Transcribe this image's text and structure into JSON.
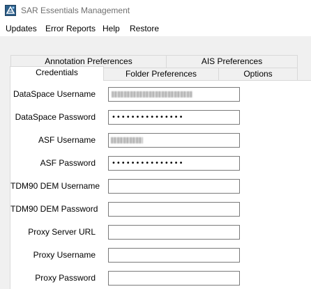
{
  "window": {
    "title": "SAR Essentials Management",
    "icon": "sar-app-icon"
  },
  "menu": {
    "items": [
      "Updates",
      "Error Reports",
      "Help",
      "Restore"
    ]
  },
  "tabs": {
    "back_row": [
      "Annotation Preferences",
      "AIS Preferences"
    ],
    "front_row": [
      "Credentials",
      "Folder Preferences",
      "Options"
    ],
    "active": "Credentials"
  },
  "credentials": {
    "fields": [
      {
        "label": "DataSpace Username",
        "type": "text",
        "value": "",
        "obscured": true
      },
      {
        "label": "DataSpace Password",
        "type": "password",
        "value": "•••••••••••••••"
      },
      {
        "label": "ASF Username",
        "type": "text",
        "value": "",
        "obscured": true
      },
      {
        "label": "ASF Password",
        "type": "password",
        "value": "•••••••••••••••"
      },
      {
        "label": "TDM90 DEM Username",
        "type": "text",
        "value": ""
      },
      {
        "label": "TDM90 DEM Password",
        "type": "password",
        "value": ""
      },
      {
        "label": "Proxy Server URL",
        "type": "text",
        "value": ""
      },
      {
        "label": "Proxy Username",
        "type": "text",
        "value": ""
      },
      {
        "label": "Proxy Password",
        "type": "password",
        "value": ""
      }
    ]
  }
}
